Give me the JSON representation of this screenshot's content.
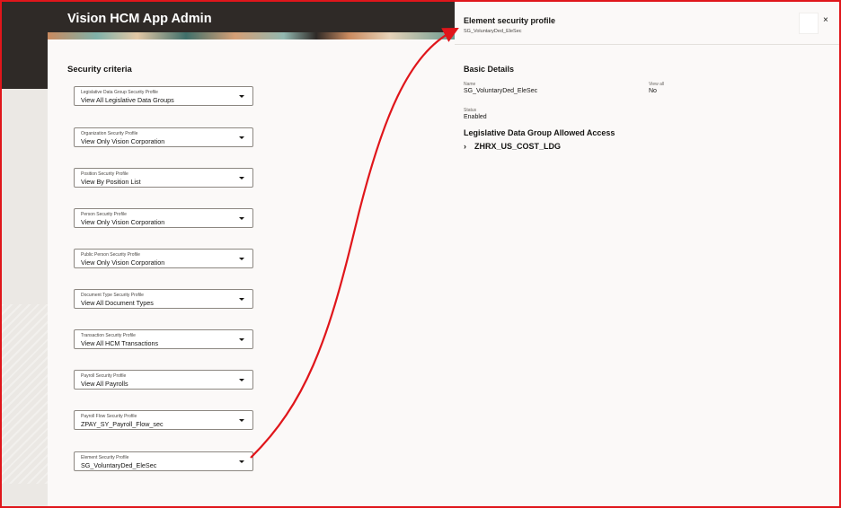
{
  "app": {
    "title": "Vision HCM App Admin"
  },
  "main": {
    "section_title": "Security criteria",
    "fields": [
      {
        "label": "Legislative Data Group Security Profile",
        "value": "View All Legislative Data Groups"
      },
      {
        "label": "Organization Security Profile",
        "value": "View Only Vision Corporation"
      },
      {
        "label": "Position Security Profile",
        "value": "View By Position List"
      },
      {
        "label": "Person Security Profile",
        "value": "View Only Vision Corporation"
      },
      {
        "label": "Public Person Security Profile",
        "value": "View Only Vision Corporation"
      },
      {
        "label": "Document Type Security Profile",
        "value": "View All Document Types"
      },
      {
        "label": "Transaction Security Profile",
        "value": "View All HCM Transactions"
      },
      {
        "label": "Payroll Security Profile",
        "value": "View All Payrolls"
      },
      {
        "label": "Payroll Flow Security Profile",
        "value": "ZPAY_SY_Payroll_Flow_sec"
      },
      {
        "label": "Element Security Profile",
        "value": "SG_VoluntaryDed_EleSec"
      }
    ]
  },
  "drawer": {
    "title": "Element security profile",
    "subtitle": "SG_VoluntaryDed_EleSec",
    "close_icon": "×",
    "basic_details_title": "Basic Details",
    "name_label": "Name",
    "name_value": "SG_VoluntaryDed_EleSec",
    "view_all_label": "View all",
    "view_all_value": "No",
    "status_label": "Status",
    "status_value": "Enabled",
    "ldg_title": "Legislative Data Group Allowed Access",
    "expand_icon": "›",
    "ldg_items": [
      "ZHRX_US_COST_LDG"
    ]
  },
  "colors": {
    "annotation": "#e0161b",
    "header_dark": "#2f2a27",
    "panel": "#fbf9f8",
    "page_bg": "#f1efed"
  },
  "icons": {
    "dropdown": "chevron-down-icon",
    "close": "close-icon",
    "expand": "chevron-right-icon"
  }
}
